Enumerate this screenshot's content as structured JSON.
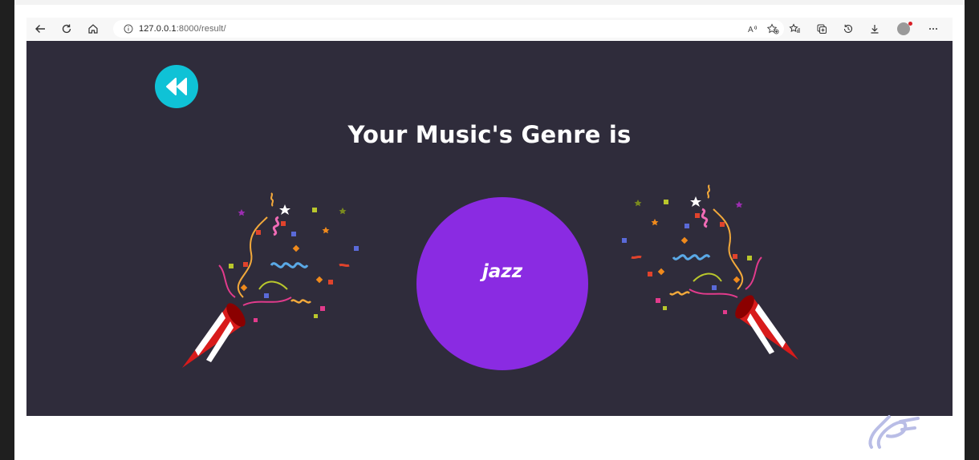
{
  "browser": {
    "url_host": "127.0.0.1",
    "url_rest": ":8000/result/",
    "icons": {
      "back": "arrow-left-icon",
      "reload": "refresh-icon",
      "home": "home-icon",
      "info": "info-icon",
      "read_aloud": "read-aloud-icon",
      "favorite": "favorite-add-icon",
      "favorites": "favorites-list-icon",
      "collections": "collections-icon",
      "history": "history-icon",
      "downloads": "download-icon",
      "profile": "profile-avatar",
      "more": "more-icon"
    }
  },
  "page": {
    "title": "Your Music's Genre is",
    "genre": "jazz",
    "colors": {
      "background": "#2f2c3b",
      "back_button": "#0fc2d6",
      "genre_circle": "#8a2be2"
    }
  }
}
